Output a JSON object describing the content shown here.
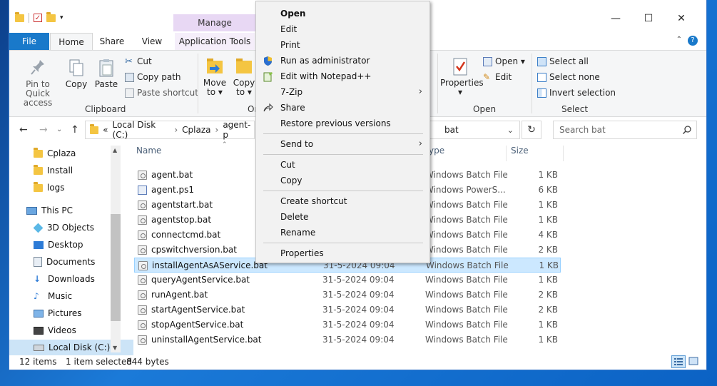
{
  "window": {
    "manage_tab": "Manage",
    "controls": {
      "minimize": "—",
      "maximize": "☐",
      "close": "✕"
    }
  },
  "ribbon_tabs": {
    "file": "File",
    "home": "Home",
    "share": "Share",
    "view": "View",
    "app_tools": "Application Tools"
  },
  "ribbon": {
    "pin_label_1": "Pin to Quick",
    "pin_label_2": "access",
    "copy": "Copy",
    "paste": "Paste",
    "cut": "Cut",
    "copy_path": "Copy path",
    "paste_shortcut": "Paste shortcut",
    "clipboard_group": "Clipboard",
    "move_to_1": "Move",
    "move_to_2": "to ▾",
    "copy_to_1": "Copy",
    "copy_to_2": "to ▾",
    "organize_group": "Or",
    "properties": "Properties",
    "properties_arrow": "▾",
    "open": "Open ▾",
    "edit": "Edit",
    "open_group": "Open",
    "select_all": "Select all",
    "select_none": "Select none",
    "invert_selection": "Invert selection",
    "select_group": "Select"
  },
  "address": {
    "prefix": "«",
    "crumbs": [
      "Local Disk (C:)",
      "Cplaza",
      "agent-p"
    ],
    "current": "bat",
    "search_placeholder": "Search bat"
  },
  "nav_pane": [
    {
      "label": "Cplaza",
      "icon": "folder-icon"
    },
    {
      "label": "Install",
      "icon": "folder-icon"
    },
    {
      "label": "logs",
      "icon": "folder-icon"
    },
    {
      "label": "This PC",
      "icon": "computer-icon"
    },
    {
      "label": "3D Objects",
      "icon": "cube-icon"
    },
    {
      "label": "Desktop",
      "icon": "desktop-icon"
    },
    {
      "label": "Documents",
      "icon": "documents-icon"
    },
    {
      "label": "Downloads",
      "icon": "download-icon"
    },
    {
      "label": "Music",
      "icon": "music-icon"
    },
    {
      "label": "Pictures",
      "icon": "pictures-icon"
    },
    {
      "label": "Videos",
      "icon": "videos-icon"
    },
    {
      "label": "Local Disk (C:)",
      "icon": "drive-icon"
    }
  ],
  "columns": {
    "name": "Name",
    "type": "ype",
    "size": "Size"
  },
  "files": [
    {
      "name": "agent.bat",
      "date": "",
      "type": "Windows Batch File",
      "size": "1 KB",
      "icon": "bat"
    },
    {
      "name": "agent.ps1",
      "date": "",
      "type": "Windows PowerS...",
      "size": "6 KB",
      "icon": "ps"
    },
    {
      "name": "agentstart.bat",
      "date": "",
      "type": "Windows Batch File",
      "size": "1 KB",
      "icon": "bat"
    },
    {
      "name": "agentstop.bat",
      "date": "",
      "type": "Windows Batch File",
      "size": "1 KB",
      "icon": "bat"
    },
    {
      "name": "connectcmd.bat",
      "date": "",
      "type": "Windows Batch File",
      "size": "4 KB",
      "icon": "bat"
    },
    {
      "name": "cpswitchversion.bat",
      "date": "",
      "type": "Windows Batch File",
      "size": "2 KB",
      "icon": "bat"
    },
    {
      "name": "installAgentAsAService.bat",
      "date": "31-5-2024 09:04",
      "type": "Windows Batch File",
      "size": "1 KB",
      "icon": "bat",
      "selected": true
    },
    {
      "name": "queryAgentService.bat",
      "date": "31-5-2024 09:04",
      "type": "Windows Batch File",
      "size": "1 KB",
      "icon": "bat"
    },
    {
      "name": "runAgent.bat",
      "date": "31-5-2024 09:04",
      "type": "Windows Batch File",
      "size": "2 KB",
      "icon": "bat"
    },
    {
      "name": "startAgentService.bat",
      "date": "31-5-2024 09:04",
      "type": "Windows Batch File",
      "size": "2 KB",
      "icon": "bat"
    },
    {
      "name": "stopAgentService.bat",
      "date": "31-5-2024 09:04",
      "type": "Windows Batch File",
      "size": "1 KB",
      "icon": "bat"
    },
    {
      "name": "uninstallAgentService.bat",
      "date": "31-5-2024 09:04",
      "type": "Windows Batch File",
      "size": "1 KB",
      "icon": "bat"
    }
  ],
  "status": {
    "count": "12 items",
    "selected": "1 item selected",
    "size": "844 bytes"
  },
  "context_menu": {
    "open": "Open",
    "edit": "Edit",
    "print": "Print",
    "run_as_admin": "Run as administrator",
    "edit_notepadpp": "Edit with Notepad++",
    "seven_zip": "7-Zip",
    "share": "Share",
    "restore": "Restore previous versions",
    "send_to": "Send to",
    "cut": "Cut",
    "copy": "Copy",
    "create_shortcut": "Create shortcut",
    "delete": "Delete",
    "rename": "Rename",
    "properties": "Properties",
    "submenu_arrow": "›"
  }
}
